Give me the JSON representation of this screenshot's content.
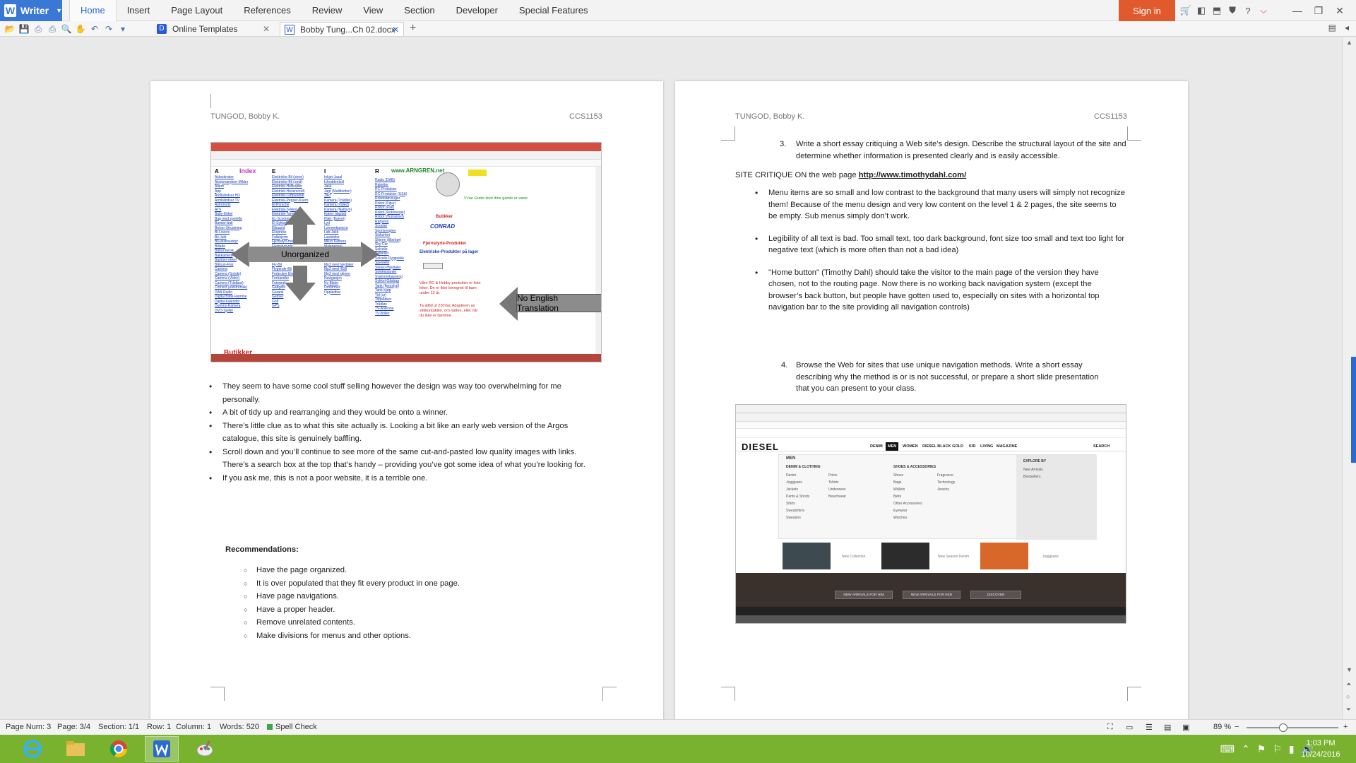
{
  "app": {
    "name": "Writer",
    "menu_tabs": [
      "Home",
      "Insert",
      "Page Layout",
      "References",
      "Review",
      "View",
      "Section",
      "Developer",
      "Special Features"
    ],
    "active_tab": "Home",
    "sign_in": "Sign in"
  },
  "doc_tabs": {
    "templates": "Online Templates",
    "current": "Bobby Tung...Ch 02.docx"
  },
  "colors": {
    "accent": "#2b6bd1",
    "signin": "#e05a2e",
    "taskbar": "#78b22f"
  },
  "left_page": {
    "header_left": "TUNGOD, Bobby K.",
    "header_right": "CCS1153",
    "screenshot": {
      "site_title": "www.ARNGREN.net",
      "index_label": "Index",
      "butikker_label": "Butikker",
      "callout_unorganized": "Unorganized",
      "callout_translation": "No English Translation"
    },
    "bullets": [
      "They seem to have some cool stuff selling however the design was way too overwhelming for me personally.",
      "A bit of tidy up and rearranging and they would be onto a winner.",
      "There’s little clue as to what this site actually is. Looking a bit like an early web version of the Argos catalogue, this site is genuinely baffling.",
      "Scroll down and you’ll continue to see more of the same cut-and-pasted low quality images with links. There’s a search box at the top that’s handy – providing you’ve got some idea of what you’re looking for.",
      "If you ask me, this is not a poor website, it is a terrible one."
    ],
    "recommendations_title": "Recommendations:",
    "recommendations": [
      "Have the page organized.",
      "It is over populated that they fit every product in one page.",
      "Have page navigations.",
      "Have a proper header.",
      "Remove unrelated contents.",
      "Make divisions for menus and other options."
    ]
  },
  "right_page": {
    "header_left": "TUNGOD, Bobby K.",
    "header_right": "CCS1153",
    "item3_number": "3.",
    "item3_text": "Write a short essay critiquing a Web site’s design. Describe the structural layout of the site and determine whether information is presented clearly and is easily accessible.",
    "critique_prefix": "SITE CRITIQUE ON the web page ",
    "critique_url": "http://www.timothydahl.com/",
    "bullets": [
      "Menu items are so small and low contrast to the background that many users will simply not recognize them! Because of the menu design and very low content on the level 1 & 2 pages, the site seems to be empty. Sub menus simply don’t work.",
      "Legibility of all text is bad. Too small text, too dark background, font size too small and text too light for negative text (which is more often than not a bad idea)",
      "\"Home button\" (Timothy Dahl) should take the visitor to the main page of the version they have chosen, not to the routing page. Now there is no working back navigation system (except the browser’s back button, but people have gotten used to, especially on sites with a horizontal top navigation bar to the site providing all navigation controls)"
    ],
    "item4_number": "4.",
    "item4_text": "Browse the Web for sites that use unique navigation methods. Write a short essay describing why the method is or is not successful, or prepare a short slide presentation that you can present to your class.",
    "diesel": {
      "logo": "DIESEL",
      "menu": [
        "DENIM",
        "MEN",
        "WOMEN",
        "DIESEL BLACK GOLD",
        "KID",
        "LIVING",
        "MAGAZINE"
      ],
      "search": "SEARCH",
      "section": "MEN",
      "col1_title": "DENIM & CLOTHING",
      "col1_items": [
        "Denim",
        "Joggjeans",
        "Jackets",
        "Pants & Shorts",
        "Shirts",
        "Sweatshirts",
        "Sweaters"
      ],
      "col2_items": [
        "Polos",
        "Tshirts",
        "Underwear",
        "Beachwear"
      ],
      "col3_title": "SHOES & ACCESSORIES",
      "col3_items": [
        "Shoes",
        "Bags",
        "Wallets",
        "Belts",
        "Other Accessories",
        "Eyewear",
        "Watches"
      ],
      "col4_items": [
        "Fragrance",
        "Technology",
        "Jewelry"
      ],
      "col5_title": "EXPLORE BY",
      "col5_items": [
        "New Arrivals",
        "Bestsellers"
      ],
      "tile_captions": [
        "New Collection",
        "New Season Denim",
        "Joggjeans"
      ],
      "buttons": [
        "NEW ARRIVALS FOR HIM",
        "NEW ARRIVALS FOR HER",
        "DISCOVER"
      ]
    }
  },
  "status": {
    "page_num": "Page Num: 3",
    "page": "Page: 3/4",
    "section": "Section: 1/1",
    "row": "Row: 1",
    "column": "Column: 1",
    "words": "Words: 520",
    "spell": "Spell Check",
    "zoom": "89 %",
    "zoom_level": 0.4
  },
  "taskbar": {
    "time": "1:03 PM",
    "date": "10/24/2016"
  }
}
